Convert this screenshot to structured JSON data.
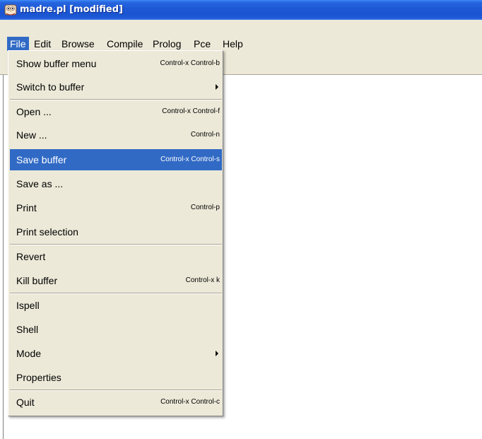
{
  "window": {
    "title": "madre.pl [modified]"
  },
  "icons": {
    "app": "swi-prolog-owl-icon",
    "submenu": "submenu-arrow-icon"
  },
  "colors": {
    "titlebar": "#1a54d1",
    "menubar": "#ece9d8",
    "highlight": "#316ac5"
  },
  "menubar": {
    "items": [
      {
        "label": "File"
      },
      {
        "label": "Edit"
      },
      {
        "label": "Browse"
      },
      {
        "label": "Compile"
      },
      {
        "label": "Prolog"
      },
      {
        "label": "Pce"
      },
      {
        "label": "Help"
      }
    ],
    "active": "File"
  },
  "file_menu": {
    "items": [
      {
        "label": "Show buffer menu",
        "shortcut": "Control-x Control-b"
      },
      {
        "label": "Switch to buffer",
        "shortcut": ""
      },
      {
        "label": "Open ...",
        "shortcut": "Control-x Control-f"
      },
      {
        "label": "New ...",
        "shortcut": "Control-n"
      },
      {
        "label": "Save buffer",
        "shortcut": "Control-x Control-s"
      },
      {
        "label": "Save as ...",
        "shortcut": ""
      },
      {
        "label": "Print",
        "shortcut": "Control-p"
      },
      {
        "label": "Print selection",
        "shortcut": ""
      },
      {
        "label": "Revert",
        "shortcut": ""
      },
      {
        "label": "Kill buffer",
        "shortcut": "Control-x k"
      },
      {
        "label": "Ispell",
        "shortcut": ""
      },
      {
        "label": "Shell",
        "shortcut": ""
      },
      {
        "label": "Mode",
        "shortcut": ""
      },
      {
        "label": "Properties",
        "shortcut": ""
      },
      {
        "label": "Quit",
        "shortcut": "Control-x Control-c"
      }
    ],
    "highlighted": "Save buffer"
  }
}
